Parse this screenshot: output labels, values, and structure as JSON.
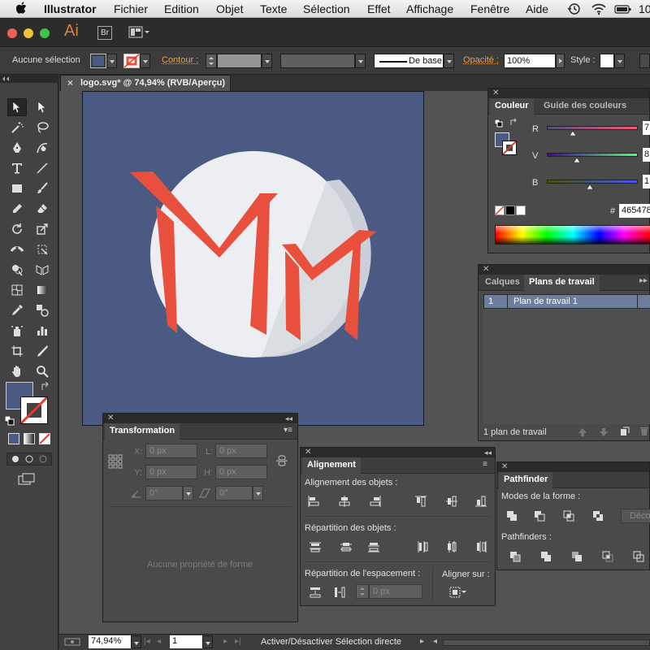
{
  "menubar": {
    "app": "Illustrator",
    "items": [
      "Fichier",
      "Edition",
      "Objet",
      "Texte",
      "Sélection",
      "Effet",
      "Affichage",
      "Fenêtre",
      "Aide"
    ],
    "clock": "10"
  },
  "titlebar": {
    "logo": "Ai",
    "bridge": "Br"
  },
  "control": {
    "selection_label": "Aucune sélection",
    "contour_label": "Contour :",
    "stroke_style": "De base",
    "opacity_label": "Opacité :",
    "opacity_value": "100%",
    "style_label": "Style :",
    "fill_color": "#4a5a82"
  },
  "document": {
    "tab_title": "logo.svg* @ 74,94% (RVB/Aperçu)",
    "artboard_bg": "#4a5a82",
    "circle_color": "#eceef1",
    "letter_color": "#e8503d"
  },
  "couleur": {
    "tabs": [
      "Couleur",
      "Guide des couleurs"
    ],
    "channels": [
      {
        "label": "R",
        "value": "7"
      },
      {
        "label": "V",
        "value": "8"
      },
      {
        "label": "B",
        "value": "1"
      }
    ],
    "hex_label": "#",
    "hex_value": "465478"
  },
  "calques": {
    "tabs": [
      "Calques",
      "Plans de travail"
    ],
    "rows": [
      {
        "index": "1",
        "name": "Plan de travail 1"
      }
    ],
    "footer": "1 plan de travail"
  },
  "transformation": {
    "tab": "Transformation",
    "x_label": "X:",
    "x_value": "0 px",
    "l_label": "L:",
    "l_value": "0 px",
    "y_label": "Y:",
    "y_value": "0 px",
    "h_label": "H:",
    "h_value": "0 px",
    "angle_value": "0°",
    "shear_value": "0°",
    "empty_text": "Aucune propriété de forme"
  },
  "alignement": {
    "tab": "Alignement",
    "section1": "Alignement des objets :",
    "section2": "Répartition des objets :",
    "section3": "Répartition de l'espacement :",
    "align_to": "Aligner sur :",
    "spacing_value": "0 px"
  },
  "pathfinder": {
    "tab": "Pathfinder",
    "modes_label": "Modes de la forme :",
    "pathfinders_label": "Pathfinders :",
    "decompose": "Déco"
  },
  "statusbar": {
    "zoom": "74,94%",
    "page": "1",
    "message": "Activer/Désactiver Sélection directe"
  }
}
